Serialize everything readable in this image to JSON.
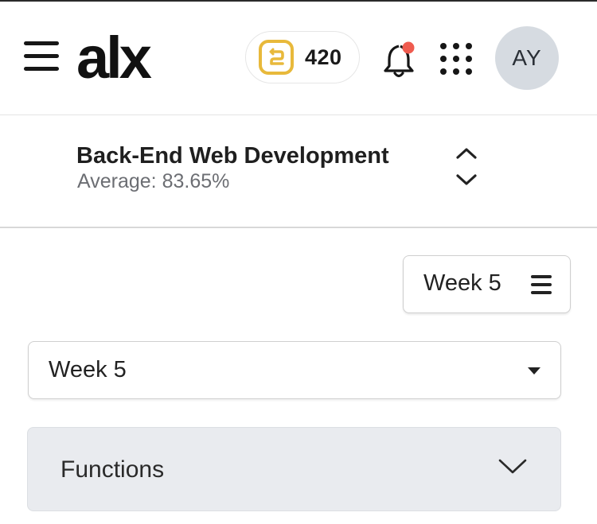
{
  "header": {
    "logo_text": "alx",
    "points": "420",
    "avatar_initials": "AY",
    "colors": {
      "coin": "#e8b93b",
      "notification_dot": "#ef5b4f",
      "avatar_bg": "#d6dbe1"
    }
  },
  "course": {
    "title": "Back-End Web Development",
    "average_label": "Average:",
    "average_value": "83.65%"
  },
  "week_button": {
    "label": "Week 5"
  },
  "week_select": {
    "selected": "Week 5"
  },
  "section": {
    "title": "Functions"
  },
  "icons": [
    "hamburger-menu-icon",
    "coin-icon",
    "bell-icon",
    "apps-grid-icon",
    "chevron-up-icon",
    "chevron-down-icon",
    "list-icon",
    "caret-down-icon"
  ]
}
